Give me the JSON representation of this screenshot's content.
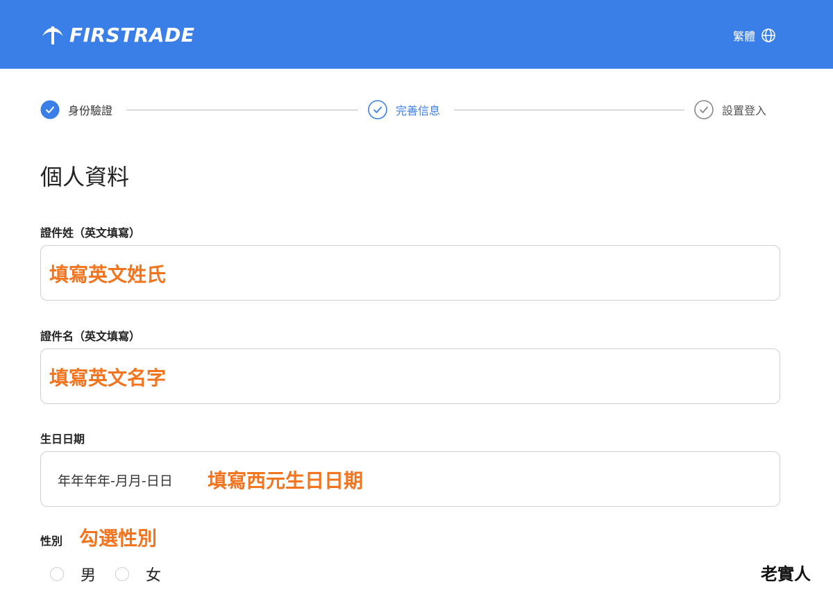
{
  "header": {
    "brand": "FIRSTRADE",
    "language_label": "繁體",
    "icons": {
      "logo": "firstrade-logo-icon",
      "language": "globe-icon"
    },
    "colors": {
      "bar": "#3a7fe8"
    }
  },
  "steps": [
    {
      "label": "身份驗證",
      "state": "completed"
    },
    {
      "label": "完善信息",
      "state": "current"
    },
    {
      "label": "設置登入",
      "state": "pending"
    }
  ],
  "section": {
    "title": "個人資料"
  },
  "form": {
    "last_name": {
      "label": "證件姓（英文填寫）",
      "annotation": "填寫英文姓氏"
    },
    "first_name": {
      "label": "證件名（英文填寫）",
      "annotation": "填寫英文名字"
    },
    "birthday": {
      "label": "生日日期",
      "placeholder": "年年年年-月月-日日",
      "annotation": "填寫西元生日日期"
    },
    "gender": {
      "label": "性別",
      "annotation": "勾選性別",
      "options": [
        "男",
        "女"
      ]
    }
  },
  "accent_colors": {
    "annotation": "#f3741f",
    "step_active": "#3a7fe8",
    "step_pending": "#888888"
  },
  "watermark": "老實人"
}
